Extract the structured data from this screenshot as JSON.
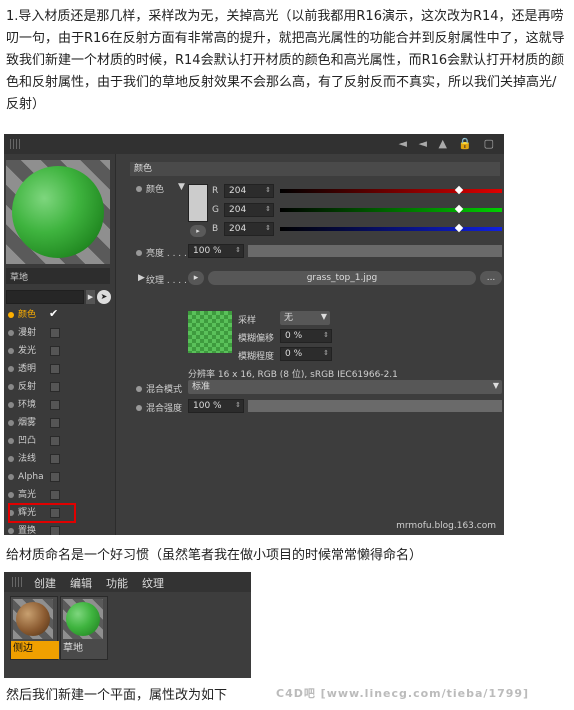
{
  "para1": "1.导入材质还是那几样，采样改为无，关掉高光（以前我都用R16演示，这次改为R14，还是再唠叨一句，由于R16在反射方面有非常高的提升，就把高光属性的功能合并到反射属性中了，这就导致我们新建一个材质的时候，R14会默认打开材质的颜色和高光属性，而R16会默认打开材质的颜色和反射属性，由于我们的草地反射效果不会那么高，有了反射反而不真实，所以我们关掉高光/反射）",
  "para2": "给材质命名是一个好习惯（虽然笔者我在做小项目的时候常常懒得命名）",
  "para3": "然后我们新建一个平面，属性改为如下",
  "editor": {
    "material_name": "草地",
    "channels": [
      {
        "label": "颜色",
        "checked": true
      },
      {
        "label": "漫射",
        "checked": false
      },
      {
        "label": "发光",
        "checked": false
      },
      {
        "label": "透明",
        "checked": false
      },
      {
        "label": "反射",
        "checked": false
      },
      {
        "label": "环境",
        "checked": false
      },
      {
        "label": "烟雾",
        "checked": false
      },
      {
        "label": "凹凸",
        "checked": false
      },
      {
        "label": "法线",
        "checked": false
      },
      {
        "label": "Alpha",
        "checked": false
      },
      {
        "label": "高光",
        "checked": false
      },
      {
        "label": "辉光",
        "checked": false
      },
      {
        "label": "置换",
        "checked": false
      }
    ],
    "section_header": "颜色",
    "color_label": "颜色",
    "r_label": "R",
    "r_value": "204",
    "g_label": "G",
    "g_value": "204",
    "b_label": "B",
    "b_value": "204",
    "brightness_label": "亮度 . . . .",
    "brightness_value": "100 %",
    "texture_label": "纹理 . . . .",
    "texture_file": "grass_top_1.jpg",
    "texture_more": "...",
    "sampling_label": "采样",
    "sampling_value": "无",
    "blur_offset_label": "模糊偏移",
    "blur_offset_value": "0 %",
    "blur_scale_label": "模糊程度",
    "blur_scale_value": "0 %",
    "resolution_info": "分辨率 16 x 16, RGB (8 位), sRGB IEC61966-2.1",
    "mix_mode_label": "混合模式",
    "mix_mode_value": "标准",
    "mix_strength_label": "混合强度",
    "mix_strength_value": "100 %",
    "watermark": "mrmofu.blog.163.com"
  },
  "manager": {
    "menu": [
      "创建",
      "编辑",
      "功能",
      "纹理"
    ],
    "materials": [
      "侧边",
      "草地"
    ]
  },
  "credit": "C4D吧 [www.linecg.com/tieba/1799]",
  "colors": {
    "highlight": "#e00000",
    "accent": "#ffb000"
  }
}
